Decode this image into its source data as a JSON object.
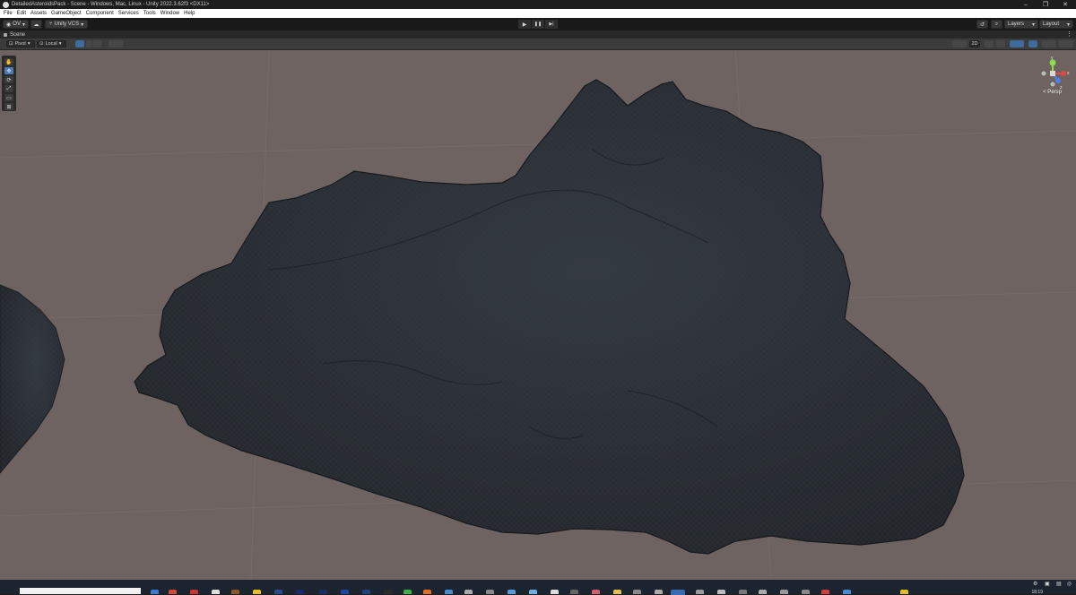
{
  "window": {
    "title": "DetailedAsteroidsPack - Scene - Windows, Mac, Linux - Unity 2022.3.62f3 <DX11>",
    "minimize": "–",
    "maximize": "❐",
    "close": "✕"
  },
  "menu": {
    "items": [
      "File",
      "Edit",
      "Assets",
      "GameObject",
      "Component",
      "Services",
      "Tools",
      "Window",
      "Help"
    ]
  },
  "toolbar": {
    "account": "OV",
    "account_arrow": "▾",
    "cloud": "☁",
    "vcs": "Unity VCS",
    "play": "▶",
    "pause": "❚❚",
    "step": "▶|",
    "history": "↺",
    "search": "⌕",
    "layers": "Layers",
    "layout": "Layout",
    "kebab": "⋮"
  },
  "scene_tab": {
    "label": "Scene",
    "menu": "⋮"
  },
  "scene_toolbar": {
    "pivot": "Pivot",
    "local": "Local",
    "mode_2d": "2D"
  },
  "tools": [
    "✋",
    "✥",
    "⟳",
    "⤢",
    "▭",
    "⊞"
  ],
  "gizmo": {
    "axis_y": "y",
    "axis_x": "x",
    "axis_z": "z",
    "projection": "< Persp"
  },
  "taskbar": {
    "time": "18:19"
  },
  "colors": {
    "viewport_bg": "#6e6360",
    "rock": "#2b2f35",
    "accent": "#4a7bb8",
    "gizmo_y": "#8be04a",
    "gizmo_x": "#e04848",
    "gizmo_z": "#4c7ff0"
  }
}
